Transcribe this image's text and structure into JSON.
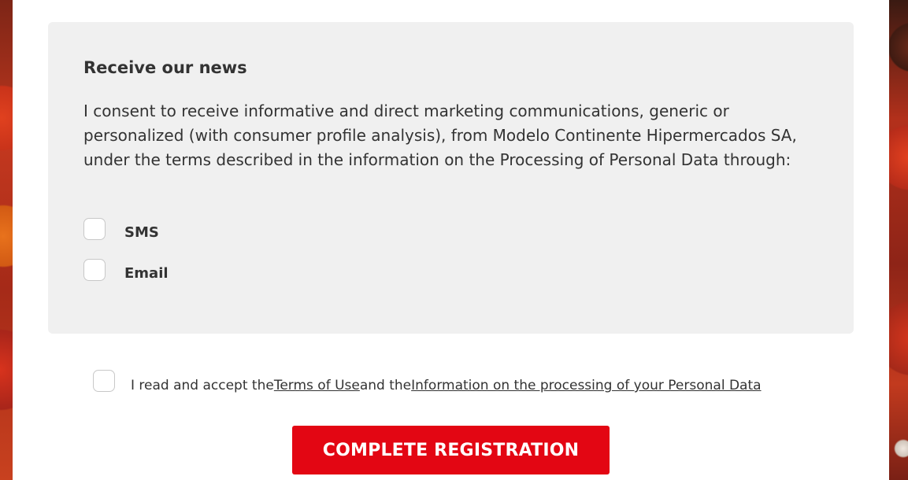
{
  "news": {
    "title": "Receive our news",
    "description": "I consent to receive informative and direct marketing communications, generic or personalized (with consumer profile analysis), from Modelo Continente Hipermercados SA, under the terms described in the information on the Processing of Personal Data through:",
    "options": [
      {
        "label": "SMS",
        "checked": false
      },
      {
        "label": "Email",
        "checked": false
      }
    ]
  },
  "terms": {
    "checked": false,
    "prefix": "I read and accept the",
    "terms_link": "Terms of Use",
    "middle": "and the",
    "privacy_link": "Information on the processing of your Personal Data"
  },
  "submit": {
    "label": "COMPLETE REGISTRATION"
  },
  "colors": {
    "accent": "#e30613",
    "panel_background": "#f0f0f0",
    "text": "#333333"
  }
}
